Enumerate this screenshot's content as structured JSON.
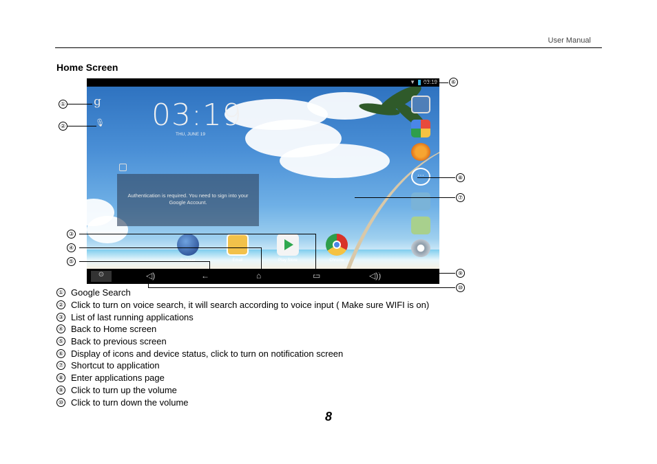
{
  "header": {
    "label": "User Manual"
  },
  "section_title": "Home Screen",
  "screen": {
    "status_time": "03:19",
    "clock": "03:19",
    "date": "THU, JUNE 19",
    "auth_message": "Authentication is required. You need to sign into your Google Account.",
    "dock_apps": [
      {
        "label": "Browser",
        "color": "#2a4e9a"
      },
      {
        "label": "Email",
        "color": "#f2c14a"
      },
      {
        "label": "Play Store",
        "color": "#e8f4e8"
      },
      {
        "label": "Chrome",
        "color": "#d8332a"
      }
    ],
    "side_icons": [
      "camera-icon",
      "gallery-icon",
      "music-icon",
      "apps-icon",
      "contacts-icon",
      "gallery2-icon",
      "settings-icon"
    ]
  },
  "callouts": [
    "①",
    "②",
    "③",
    "④",
    "⑤",
    "⑥",
    "⑦",
    "⑧",
    "⑨",
    "⑩"
  ],
  "legend": [
    {
      "num": "①",
      "text": "Google Search"
    },
    {
      "num": "②",
      "text": "Click to turn on voice search, it will search according to voice input ( Make sure WIFI is on)"
    },
    {
      "num": "③",
      "text": "List of last running applications"
    },
    {
      "num": "④",
      "text": "Back to Home screen"
    },
    {
      "num": "⑤",
      "text": "Back to previous screen"
    },
    {
      "num": "⑥",
      "text": "Display of icons and device status, click to turn on notification screen"
    },
    {
      "num": "⑦",
      "text": "Shortcut to application"
    },
    {
      "num": "⑧",
      "text": "Enter applications page"
    },
    {
      "num": "⑨",
      "text": "Click to turn up the volume"
    },
    {
      "num": "⑩",
      "text": "Click to turn down the volume"
    }
  ],
  "page_number": "8"
}
